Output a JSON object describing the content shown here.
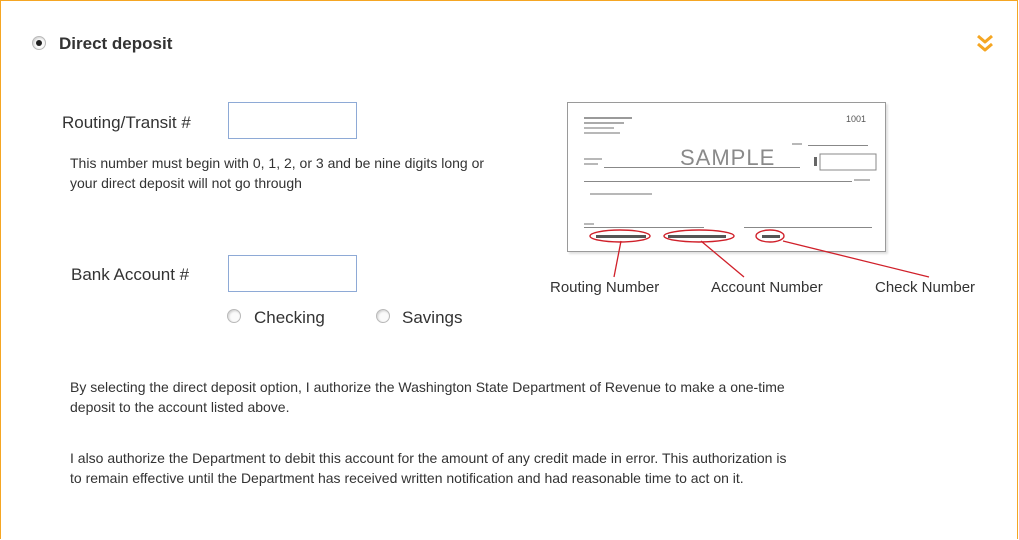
{
  "section": {
    "title": "Direct deposit",
    "expand_icon": "double-chevron-down-icon",
    "accent_color": "#f5a623"
  },
  "routing": {
    "label": "Routing/Transit #",
    "value": "",
    "help": "This number must begin with 0, 1, 2, or 3 and be nine digits long or your direct deposit will not go through"
  },
  "account": {
    "label": "Bank Account #",
    "value": "",
    "type_options": [
      {
        "label": "Checking",
        "selected": false
      },
      {
        "label": "Savings",
        "selected": false
      }
    ]
  },
  "sample_check": {
    "watermark": "SAMPLE",
    "check_number": "1001",
    "captions": [
      "Routing Number",
      "Account Number",
      "Check Number"
    ],
    "highlight_color": "#d0202a"
  },
  "authorization": {
    "paragraph1": "By selecting the direct deposit option, I authorize the Washington State Department of Revenue to make a one-time deposit to the account listed above.",
    "paragraph2": "I also authorize the Department to debit this account for the amount of any credit made in error. This authorization is to remain effective until the Department has received written notification and had reasonable time to act on it."
  }
}
